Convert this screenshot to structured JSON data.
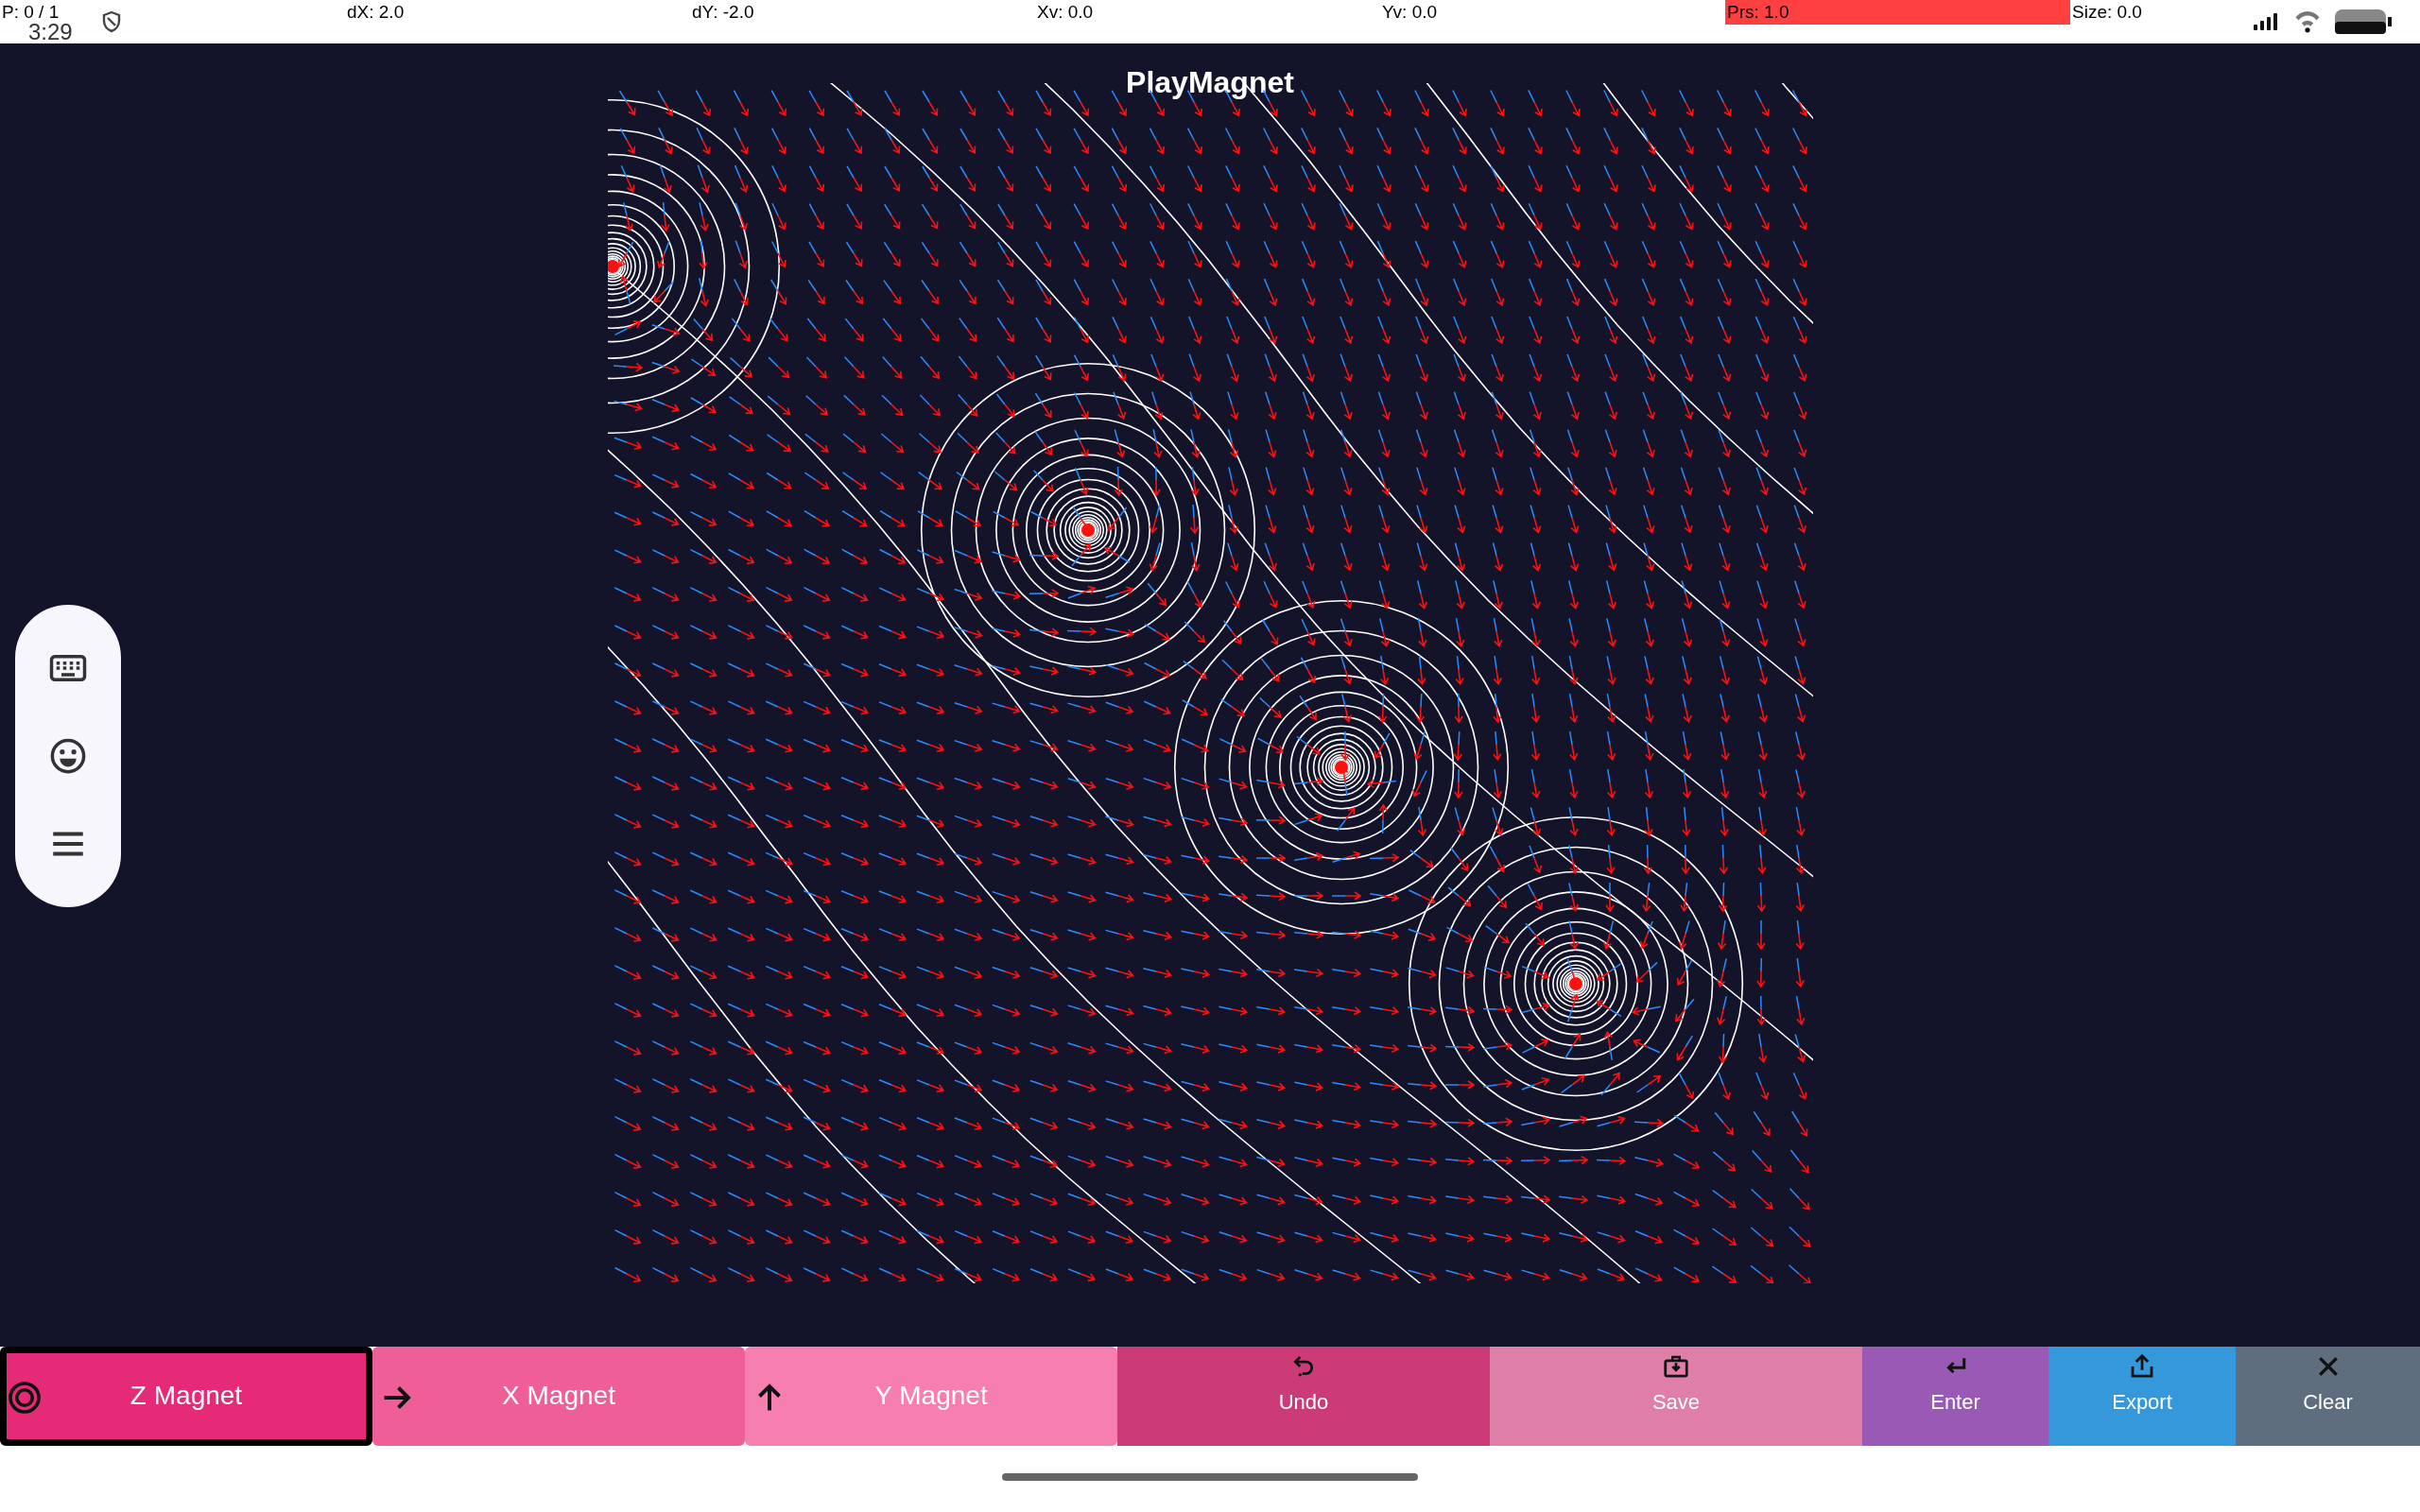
{
  "status_bar": {
    "clock": "3:29",
    "readings": [
      {
        "label": "P: 0 / 1",
        "highlighted": false
      },
      {
        "label": "dX: 2.0",
        "highlighted": false
      },
      {
        "label": "dY: -2.0",
        "highlighted": false
      },
      {
        "label": "Xv: 0.0",
        "highlighted": false
      },
      {
        "label": "Yv: 0.0",
        "highlighted": false
      },
      {
        "label": "Prs: 1.0",
        "highlighted": true
      },
      {
        "label": "Size: 0.0",
        "highlighted": false
      }
    ]
  },
  "title": "PlayMagnet",
  "buttons": [
    {
      "label": "Z Magnet",
      "kind": "mode",
      "selected": true,
      "color": "#e52a78"
    },
    {
      "label": "X Magnet",
      "kind": "mode",
      "selected": false,
      "color": "#ee5f98"
    },
    {
      "label": "Y Magnet",
      "kind": "mode",
      "selected": false,
      "color": "#f77fb0"
    },
    {
      "label": "Undo",
      "kind": "action",
      "color": "#cc3a77"
    },
    {
      "label": "Save",
      "kind": "action",
      "color": "#df7ea7"
    },
    {
      "label": "Enter",
      "kind": "action",
      "color": "#9b59b6"
    },
    {
      "label": "Export",
      "kind": "action",
      "color": "#3498db"
    },
    {
      "label": "Clear",
      "kind": "action",
      "color": "#5f6e7e"
    }
  ]
}
